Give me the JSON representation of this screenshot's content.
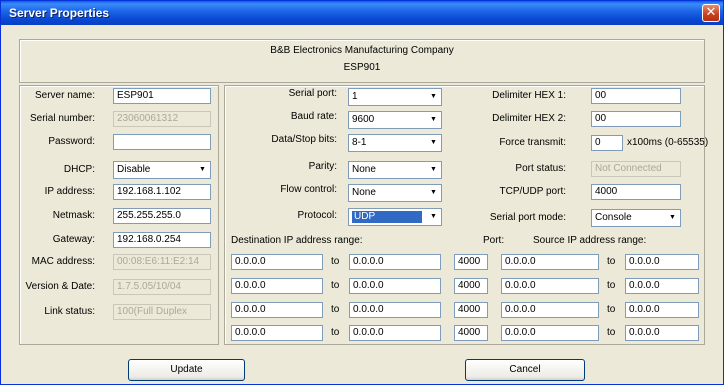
{
  "window": {
    "title": "Server Properties",
    "close_glyph": "✕",
    "colors": {
      "titlebar": "#0a46d0",
      "face": "#ece9d8",
      "close": "#c8401c"
    }
  },
  "header": {
    "company": "B&B Electronics Manufacturing Company",
    "model": "ESP901"
  },
  "left": {
    "server_name": {
      "label": "Server name:",
      "value": "ESP901"
    },
    "serial_number": {
      "label": "Serial number:",
      "value": "23060061312"
    },
    "password": {
      "label": "Password:",
      "value": ""
    },
    "dhcp": {
      "label": "DHCP:",
      "value": "Disable"
    },
    "ip_address": {
      "label": "IP address:",
      "value": "192.168.1.102"
    },
    "netmask": {
      "label": "Netmask:",
      "value": "255.255.255.0"
    },
    "gateway": {
      "label": "Gateway:",
      "value": "192.168.0.254"
    },
    "mac_address": {
      "label": "MAC address:",
      "value": "00:08:E6:11:E2:14"
    },
    "version_date": {
      "label": "Version & Date:",
      "value": "1.7.5.05/10/04"
    },
    "link_status": {
      "label": "Link status:",
      "value": "100(Full Duplex"
    }
  },
  "middle": {
    "serial_port": {
      "label": "Serial port:",
      "value": "1"
    },
    "baud_rate": {
      "label": "Baud rate:",
      "value": "9600"
    },
    "data_stop_bits": {
      "label": "Data/Stop bits:",
      "value": "8-1"
    },
    "parity": {
      "label": "Parity:",
      "value": "None"
    },
    "flow_control": {
      "label": "Flow control:",
      "value": "None"
    },
    "protocol": {
      "label": "Protocol:",
      "value": "UDP"
    }
  },
  "right": {
    "delimiter1": {
      "label": "Delimiter HEX 1:",
      "value": "00"
    },
    "delimiter2": {
      "label": "Delimiter HEX 2:",
      "value": "00"
    },
    "force_transmit": {
      "label": "Force transmit:",
      "value": "0",
      "unit": "x100ms (0-65535)"
    },
    "port_status": {
      "label": "Port status:",
      "value": "Not Connected"
    },
    "tcp_udp_port": {
      "label": "TCP/UDP port:",
      "value": "4000"
    },
    "serial_port_mode": {
      "label": "Serial port mode:",
      "value": "Console"
    }
  },
  "ranges": {
    "dest_header": "Destination IP address range:",
    "port_header": "Port:",
    "source_header": "Source IP address range:",
    "to_label": "to",
    "rows": [
      {
        "dest_from": "0.0.0.0",
        "dest_to": "0.0.0.0",
        "port": "4000",
        "src_from": "0.0.0.0",
        "src_to": "0.0.0.0"
      },
      {
        "dest_from": "0.0.0.0",
        "dest_to": "0.0.0.0",
        "port": "4000",
        "src_from": "0.0.0.0",
        "src_to": "0.0.0.0"
      },
      {
        "dest_from": "0.0.0.0",
        "dest_to": "0.0.0.0",
        "port": "4000",
        "src_from": "0.0.0.0",
        "src_to": "0.0.0.0"
      },
      {
        "dest_from": "0.0.0.0",
        "dest_to": "0.0.0.0",
        "port": "4000",
        "src_from": "0.0.0.0",
        "src_to": "0.0.0.0"
      }
    ]
  },
  "buttons": {
    "update": "Update",
    "cancel": "Cancel"
  }
}
